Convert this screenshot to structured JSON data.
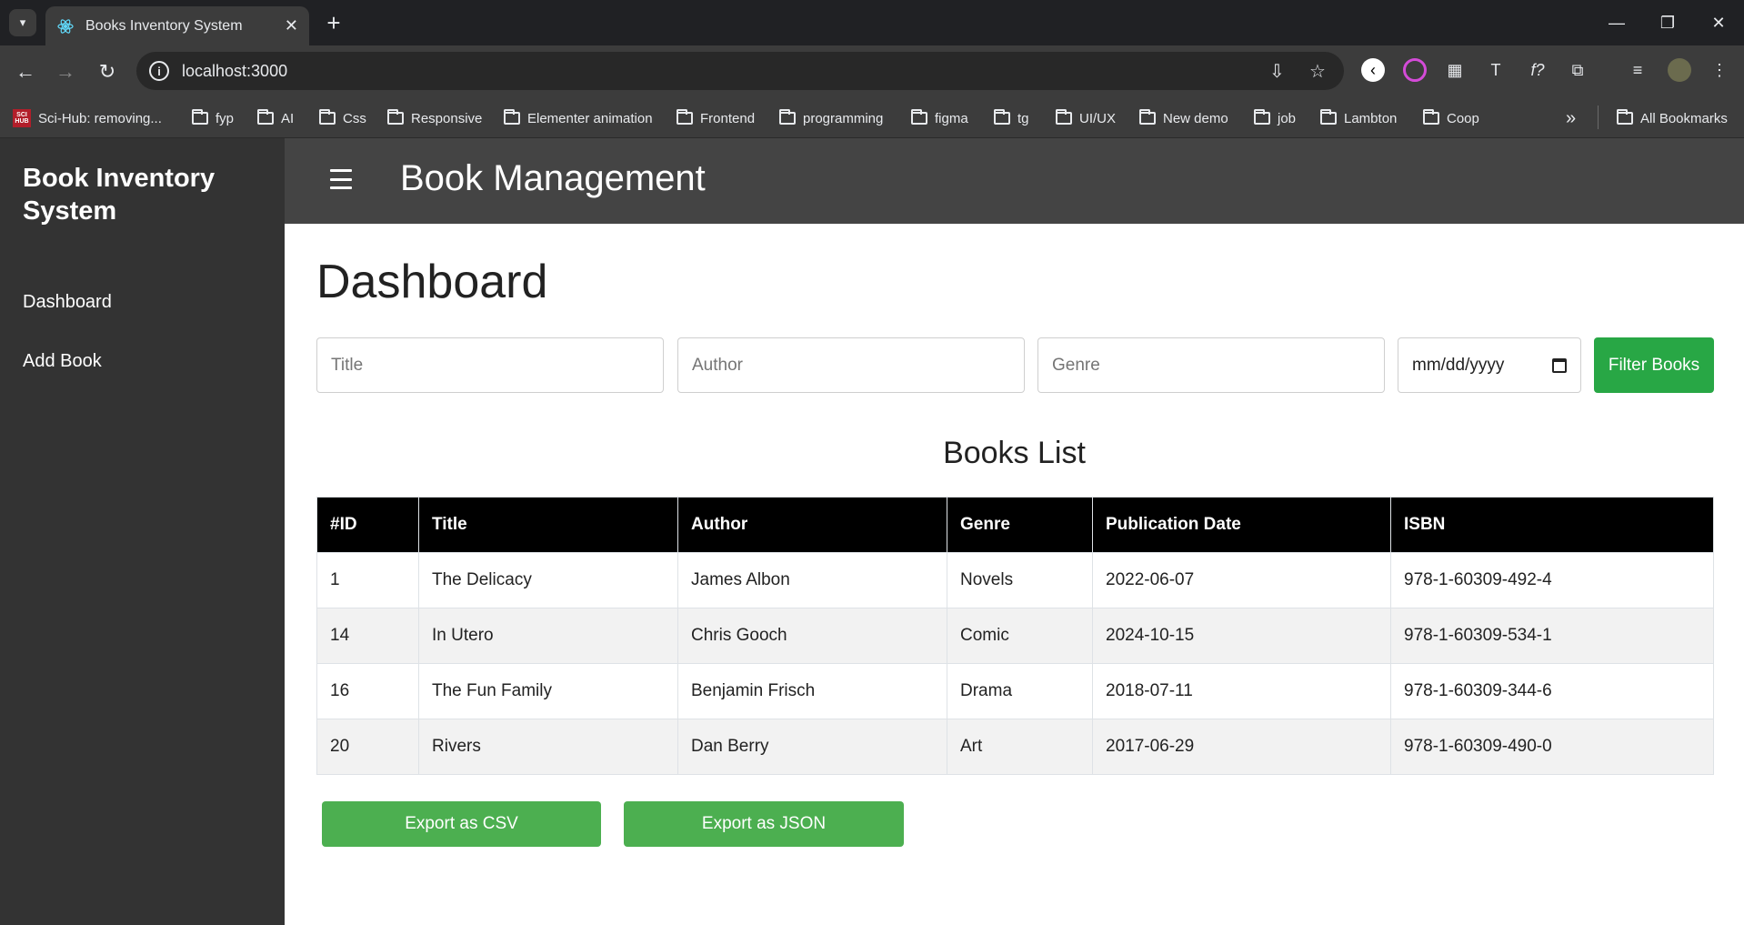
{
  "browser": {
    "tab_title": "Books Inventory System",
    "url": "localhost:3000",
    "bookmarks": [
      "Sci-Hub: removing...",
      "fyp",
      "AI",
      "Css",
      "Responsive",
      "Elementer animation",
      "Frontend",
      "programming",
      "figma",
      "tg",
      "UI/UX",
      "New demo",
      "job",
      "Lambton",
      "Coop"
    ],
    "all_bookmarks": "All Bookmarks",
    "overflow": "»"
  },
  "sidebar": {
    "brand": "Book Inventory System",
    "links": [
      "Dashboard",
      "Add Book"
    ]
  },
  "header": {
    "title": "Book Management"
  },
  "main": {
    "title": "Dashboard",
    "filters": {
      "title_placeholder": "Title",
      "author_placeholder": "Author",
      "genre_placeholder": "Genre",
      "date_placeholder": "mm/dd/yyyy",
      "button": "Filter Books"
    },
    "list_title": "Books List",
    "columns": [
      "#ID",
      "Title",
      "Author",
      "Genre",
      "Publication Date",
      "ISBN"
    ],
    "rows": [
      [
        "1",
        "The Delicacy",
        "James Albon",
        "Novels",
        "2022-06-07",
        "978-1-60309-492-4"
      ],
      [
        "14",
        "In Utero",
        "Chris Gooch",
        "Comic",
        "2024-10-15",
        "978-1-60309-534-1"
      ],
      [
        "16",
        "The Fun Family",
        "Benjamin Frisch",
        "Drama",
        "2018-07-11",
        "978-1-60309-344-6"
      ],
      [
        "20",
        "Rivers",
        "Dan Berry",
        "Art",
        "2017-06-29",
        "978-1-60309-490-0"
      ]
    ],
    "export_csv": "Export as CSV",
    "export_json": "Export as JSON"
  },
  "colors": {
    "sidebar_bg": "#333333",
    "header_bg": "#444444",
    "filter_button": "#28a745",
    "export_button": "#4caf50",
    "table_header_bg": "#000000"
  }
}
